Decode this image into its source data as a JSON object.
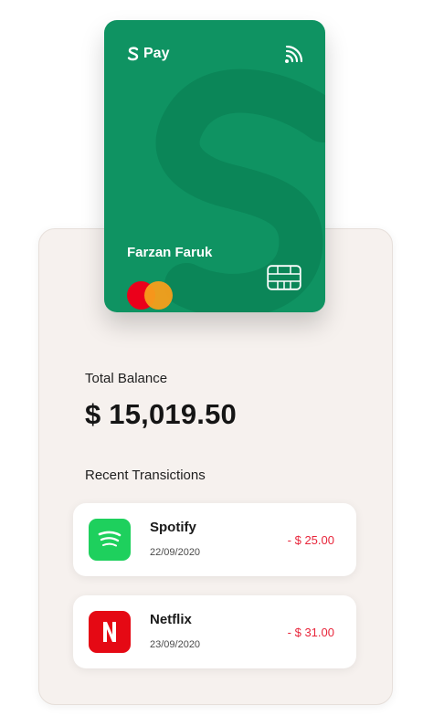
{
  "card": {
    "brand_label": "Pay",
    "holder_name": "Farzan Faruk",
    "network": "mastercard",
    "icons": [
      "brand-s-logo-icon",
      "nfc-contactless-icon",
      "mastercard-logo-icon",
      "chip-icon"
    ],
    "color": "#0f9362"
  },
  "balance": {
    "label": "Total Balance",
    "amount": "$ 15,019.50"
  },
  "recent": {
    "title": "Recent Transictions",
    "transactions": [
      {
        "name": "Spotify",
        "date": "22/09/2020",
        "amount": "- $ 25.00",
        "icon": "spotify-icon",
        "icon_color": "#1ed05d"
      },
      {
        "name": "Netflix",
        "date": "23/09/2020",
        "amount": "- $ 31.00",
        "icon": "netflix-icon",
        "icon_color": "#e50914"
      }
    ]
  },
  "colors": {
    "negative_amount": "#e8263b",
    "panel_bg": "#f6f1ee"
  }
}
